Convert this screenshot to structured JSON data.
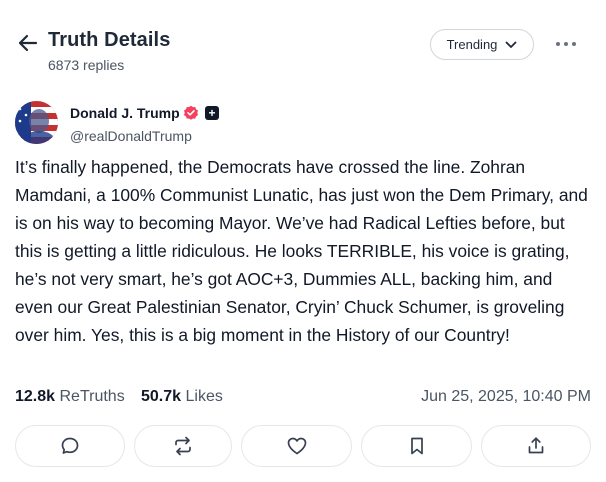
{
  "header": {
    "title": "Truth Details",
    "replies": "6873 replies",
    "sort_label": "Trending",
    "icons": {
      "back": "arrow-left-icon",
      "sort": "chevron-down-icon",
      "more": "ellipsis-horizontal-icon"
    }
  },
  "author": {
    "name": "Donald J. Trump",
    "handle": "@realDonaldTrump",
    "icons": {
      "verified": "verified-badge-icon",
      "plus": "plus-badge-icon"
    },
    "verified_color": "#f43f5e"
  },
  "post": {
    "text": "It’s finally happened, the Democrats have crossed the line. Zohran Mamdani, a 100% Communist Lunatic, has just won the Dem Primary, and is on his way to becoming Mayor. We’ve had Radical Lefties before, but this is getting a little ridiculous. He looks TERRIBLE, his voice is grating, he’s not very smart, he’s got AOC+3, Dummies ALL, backing him, and even our Great Palestinian Senator, Cryin’ Chuck Schumer, is groveling over him. Yes, this is a big moment in the History of our Country!",
    "retruths_count": "12.8k",
    "retruths_label": "ReTruths",
    "likes_count": "50.7k",
    "likes_label": "Likes",
    "timestamp": "Jun 25, 2025, 10:40 PM"
  },
  "actions": [
    {
      "name": "reply",
      "icon": "comment-icon"
    },
    {
      "name": "retruth",
      "icon": "retruth-icon"
    },
    {
      "name": "like",
      "icon": "heart-icon"
    },
    {
      "name": "bookmark",
      "icon": "bookmark-icon"
    },
    {
      "name": "share",
      "icon": "share-icon"
    }
  ]
}
